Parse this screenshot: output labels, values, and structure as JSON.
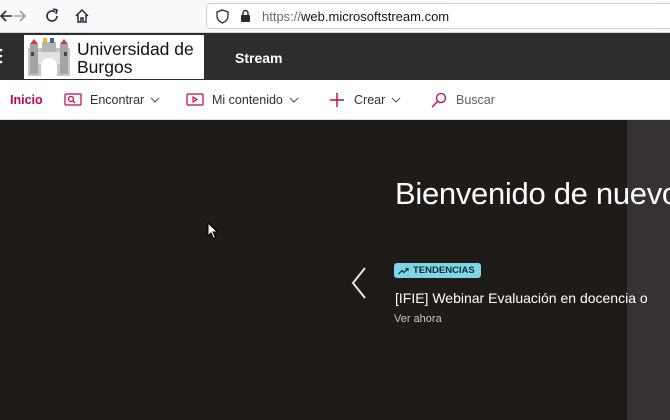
{
  "browser": {
    "url_scheme": "https://",
    "url_host": "web.microsoftstream.com"
  },
  "header": {
    "org_name": "Universidad de\nBurgos",
    "app_name": "Stream"
  },
  "command_bar": {
    "items": [
      {
        "label": "Inicio",
        "icon": "home-icon",
        "active": true
      },
      {
        "label": "Encontrar",
        "icon": "find-icon",
        "dropdown": true
      },
      {
        "label": "Mi contenido",
        "icon": "video-icon",
        "dropdown": true
      },
      {
        "label": "Crear",
        "icon": "plus-icon",
        "dropdown": true
      },
      {
        "label": "Buscar",
        "icon": "search-icon"
      }
    ]
  },
  "hero": {
    "title": "Bienvenido de nuevo",
    "badge": "TENDENCIAS",
    "video_title": "[IFIE] Webinar Evaluación en docencia o",
    "watch_label": "Ver ahora"
  },
  "colors": {
    "accent": "#c30052",
    "badge": "#7ed6e6",
    "hero_bg": "#1f1b19"
  }
}
